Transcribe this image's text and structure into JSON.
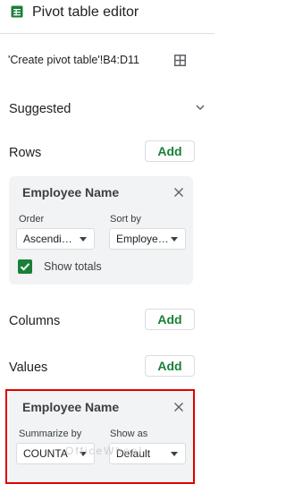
{
  "header": {
    "title": "Pivot table editor",
    "icon": "sheets-table-icon"
  },
  "range": {
    "value": "'Create pivot table'!B4:D11",
    "icon": "grid-select-icon"
  },
  "suggested": {
    "label": "Suggested"
  },
  "rows": {
    "label": "Rows",
    "add_label": "Add",
    "card": {
      "title": "Employee Name",
      "order_label": "Order",
      "order_value": "Ascendi…",
      "sortby_label": "Sort by",
      "sortby_value": "Employe…",
      "show_totals_label": "Show totals",
      "show_totals_checked": true
    }
  },
  "columns": {
    "label": "Columns",
    "add_label": "Add"
  },
  "values": {
    "label": "Values",
    "add_label": "Add",
    "card": {
      "title": "Employee Name",
      "summarize_label": "Summarize by",
      "summarize_value": "COUNTA",
      "showas_label": "Show as",
      "showas_value": "Default"
    }
  },
  "watermark": {
    "text": "OfficeWheel"
  },
  "colors": {
    "accent": "#188038",
    "highlight": "#e00000",
    "card_bg": "#f1f3f4"
  }
}
